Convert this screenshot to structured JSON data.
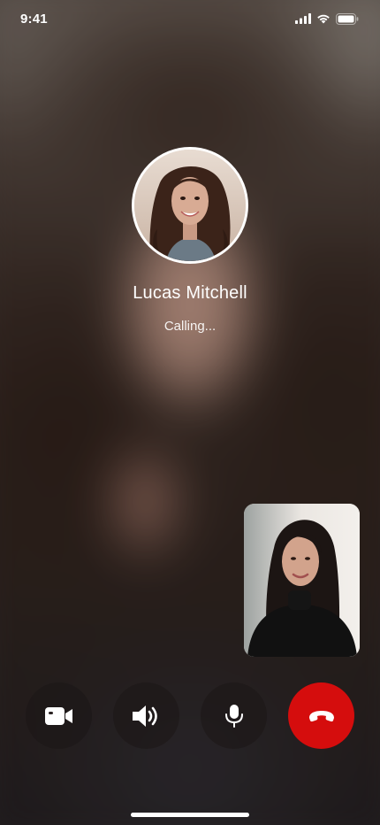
{
  "status_bar": {
    "time": "9:41",
    "icons": [
      "cellular-signal-icon",
      "wifi-icon",
      "battery-icon"
    ]
  },
  "caller": {
    "name": "Lucas Mitchell",
    "status": "Calling..."
  },
  "controls": [
    {
      "name": "video-toggle-button",
      "icon": "video-camera-icon"
    },
    {
      "name": "speaker-button",
      "icon": "speaker-icon"
    },
    {
      "name": "mute-button",
      "icon": "microphone-icon"
    },
    {
      "name": "end-call-button",
      "icon": "hang-up-icon",
      "color": "#d50d0d"
    }
  ],
  "colors": {
    "end_call": "#d50d0d",
    "text": "#ffffff"
  }
}
